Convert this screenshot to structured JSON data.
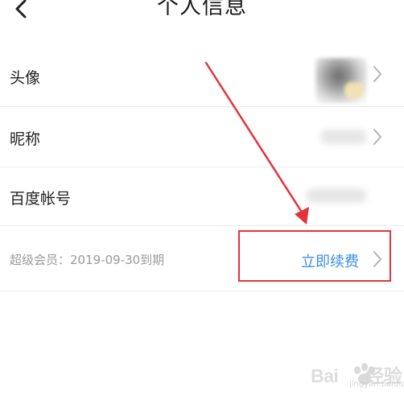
{
  "header": {
    "title": "个人信息",
    "back_icon": "chevron-left-icon"
  },
  "rows": [
    {
      "label": "头像",
      "value_kind": "avatar-image",
      "icon": "chevron-right-icon"
    },
    {
      "label": "昵称",
      "value_kind": "blurred-text",
      "icon": "chevron-right-icon"
    },
    {
      "label": "百度帐号",
      "value_kind": "blurred-text"
    }
  ],
  "membership": {
    "label": "超级会员：2019-09-30到期",
    "action_label": "立即续费",
    "action_color": "#3b8fe6",
    "icon": "chevron-right-icon"
  },
  "annotation": {
    "color": "#e5333b",
    "shapes": [
      "arrow",
      "highlight-box"
    ]
  },
  "watermark": {
    "brand": "Bai",
    "paw": "paw-icon",
    "suffix": "经验",
    "domain": "jingyan.baidu.com"
  }
}
